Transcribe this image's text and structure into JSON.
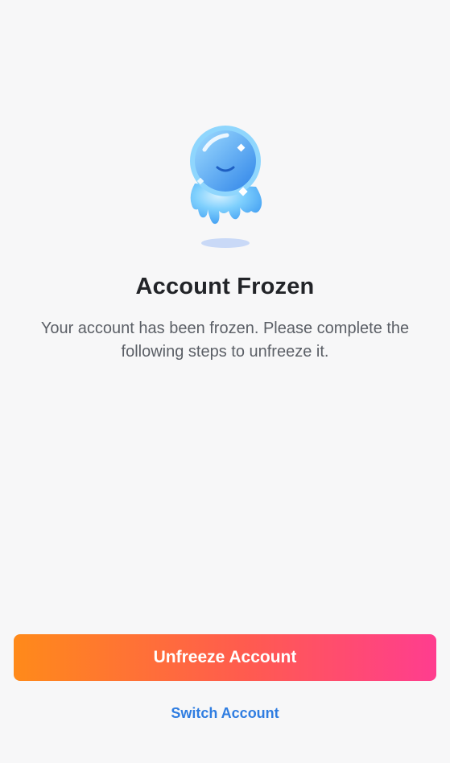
{
  "illustration": {
    "icon": "frozen-ice-mascot-icon",
    "colors": {
      "ice_light": "#bfe8ff",
      "ice_mid": "#6cc6fb",
      "ice_dark": "#3f9cf2",
      "shadow": "#c9d9f7"
    }
  },
  "content": {
    "title": "Account Frozen",
    "message": "Your account has been frozen. Please complete the following steps to unfreeze it."
  },
  "actions": {
    "unfreeze_label": "Unfreeze Account",
    "switch_label": "Switch Account"
  },
  "colors": {
    "background": "#f7f7f8",
    "button_gradient_start": "#ff8a1a",
    "button_gradient_end": "#ff3d8f",
    "link": "#2f7de1"
  }
}
